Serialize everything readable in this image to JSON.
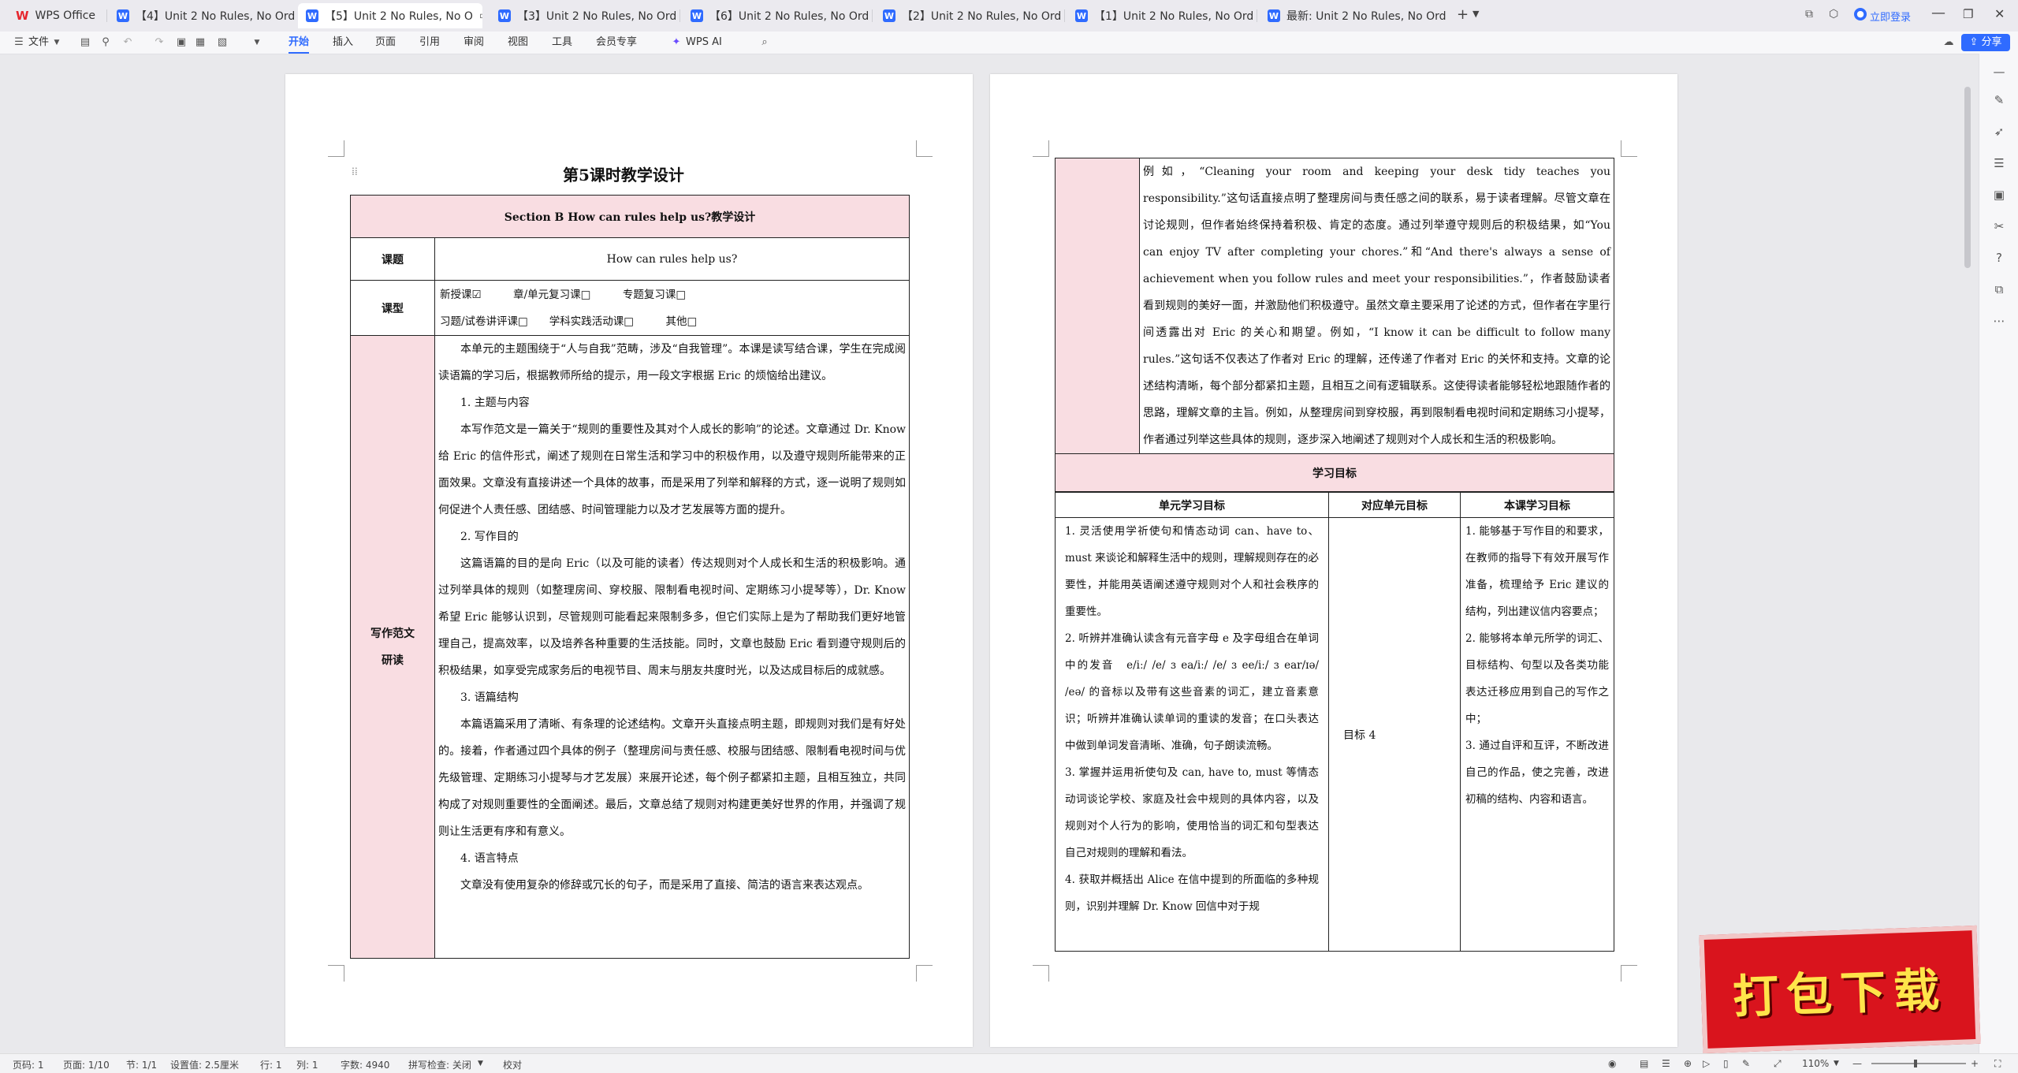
{
  "tabs": [
    {
      "label": "WPS Office",
      "kind": "home"
    },
    {
      "label": "【4】Unit 2 No Rules, No Order新…"
    },
    {
      "label": "【5】Unit 2 No Rules, No O",
      "active": true
    },
    {
      "label": "【3】Unit 2 No Rules, No Order新…"
    },
    {
      "label": "【6】Unit 2 No Rules, No Order新…"
    },
    {
      "label": "【2】Unit 2 No Rules, No Order新…"
    },
    {
      "label": "【1】Unit 2 No Rules, No Order新…"
    },
    {
      "label": "最新: Unit 2 No Rules, No Order…"
    }
  ],
  "window": {
    "login": "立即登录"
  },
  "ribbon": {
    "file": "文件",
    "menus": [
      "开始",
      "插入",
      "页面",
      "引用",
      "审阅",
      "视图",
      "工具",
      "会员专享"
    ],
    "ai": "WPS AI",
    "share": "分享"
  },
  "page1": {
    "title": "第5课时教学设计",
    "section_title": "Section B How can rules help us?教学设计",
    "r1_label": "课题",
    "r1_value": "How can rules help us?",
    "r2_label": "课型",
    "r2_line1": "新授课☑　　　章/单元复习课□　　　专题复习课□",
    "r2_line2": "习题/试卷讲评课□　　学科实践活动课□　　　其他□",
    "r3_label": "写作范文研读",
    "r3_paras": [
      "本单元的主题围绕于“人与自我”范畴，涉及“自我管理”。本课是读写结合课，学生在完成阅读语篇的学习后，根据教师所给的提示，用一段文字根据 Eric 的烦恼给出建议。",
      "1. 主题与内容",
      "本写作范文是一篇关于“规则的重要性及其对个人成长的影响”的论述。文章通过 Dr. Know 给 Eric 的信件形式，阐述了规则在日常生活和学习中的积极作用，以及遵守规则所能带来的正面效果。文章没有直接讲述一个具体的故事，而是采用了列举和解释的方式，逐一说明了规则如何促进个人责任感、团结感、时间管理能力以及才艺发展等方面的提升。",
      "2. 写作目的",
      "这篇语篇的目的是向 Eric（以及可能的读者）传达规则对个人成长和生活的积极影响。通过列举具体的规则（如整理房间、穿校服、限制看电视时间、定期练习小提琴等），Dr. Know 希望 Eric 能够认识到，尽管规则可能看起来限制多多，但它们实际上是为了帮助我们更好地管理自己，提高效率，以及培养各种重要的生活技能。同时，文章也鼓励 Eric 看到遵守规则后的积极结果，如享受完成家务后的电视节目、周末与朋友共度时光，以及达成目标后的成就感。",
      "3. 语篇结构",
      "本篇语篇采用了清晰、有条理的论述结构。文章开头直接点明主题，即规则对我们是有好处的。接着，作者通过四个具体的例子（整理房间与责任感、校服与团结感、限制看电视时间与优先级管理、定期练习小提琴与才艺发展）来展开论述，每个例子都紧扣主题，且相互独立，共同构成了对规则重要性的全面阐述。最后，文章总结了规则对构建更美好世界的作用，并强调了规则让生活更有序和有意义。",
      "4. 语言特点",
      "文章没有使用复杂的修辞或冗长的句子，而是采用了直接、简洁的语言来表达观点。"
    ]
  },
  "page2": {
    "top_text": "例如，“Cleaning your room and keeping your desk tidy teaches you responsibility.”这句话直接点明了整理房间与责任感之间的联系，易于读者理解。尽管文章在讨论规则，但作者始终保持着积极、肯定的态度。通过列举遵守规则后的积极结果，如“You can enjoy TV after completing your chores.”和“And there's always a sense of achievement when you follow rules and meet your responsibilities.”，作者鼓励读者看到规则的美好一面，并激励他们积极遵守。虽然文章主要采用了论述的方式，但作者在字里行间透露出对 Eric 的关心和期望。例如，“I know it can be difficult to follow many rules.”这句话不仅表达了作者对 Eric 的理解，还传递了作者对 Eric 的关怀和支持。文章的论述结构清晰，每个部分都紧扣主题，且相互之间有逻辑联系。这使得读者能够轻松地跟随作者的思路，理解文章的主旨。例如，从整理房间到穿校服，再到限制看电视时间和定期练习小提琴，作者通过列举这些具体的规则，逐步深入地阐述了规则对个人成长和生活的积极影响。",
    "goals_header": "学习目标",
    "col_headers": [
      "单元学习目标",
      "对应单元目标",
      "本课学习目标"
    ],
    "unit_goals": "1. 灵活使用学祈使句和情态动词 can、have to、must 来谈论和解释生活中的规则，理解规则存在的必要性，并能用英语阐述遵守规则对个人和社会秩序的重要性。\n2. 听辨并准确认读含有元音字母 e 及字母组合在单词中的发音　e/iː/ /e/ ɜ ea/iː/ /e/ ɜ ee/iː/ ɜ ear/ɪə/ /eə/ 的音标以及带有这些音素的词汇，建立音素意识；听辨并准确认读单词的重读的发音；在口头表达中做到单词发音清晰、准确，句子朗读流畅。\n3. 掌握并运用祈使句及 can, have to, must 等情态动词谈论学校、家庭及社会中规则的具体内容，以及规则对个人行为的影响，使用恰当的词汇和句型表达自己对规则的理解和看法。\n4. 获取并概括出 Alice 在信中提到的所面临的多种规则，识别并理解 Dr. Know 回信中对于规",
    "mapped": "目标 4",
    "lesson_goals": "1. 能够基于写作目的和要求，在教师的指导下有效开展写作准备，梳理给予 Eric 建议的结构，列出建议信内容要点；\n2. 能够将本单元所学的词汇、目标结构、句型以及各类功能表达迁移应用到自己的写作之中；\n3. 通过自评和互评，不断改进自己的作品，使之完善，改进初稿的结构、内容和语言。"
  },
  "statusbar": {
    "page_num": "页码: 1",
    "pages": "页面: 1/10",
    "section": "节: 1/1",
    "setting": "设置值: 2.5厘米",
    "row": "行: 1",
    "col": "列: 1",
    "words": "字数: 4940",
    "spell": "拼写检查: 关闭",
    "proof": "校对",
    "zoom": "110%"
  },
  "badge": "打包下载"
}
